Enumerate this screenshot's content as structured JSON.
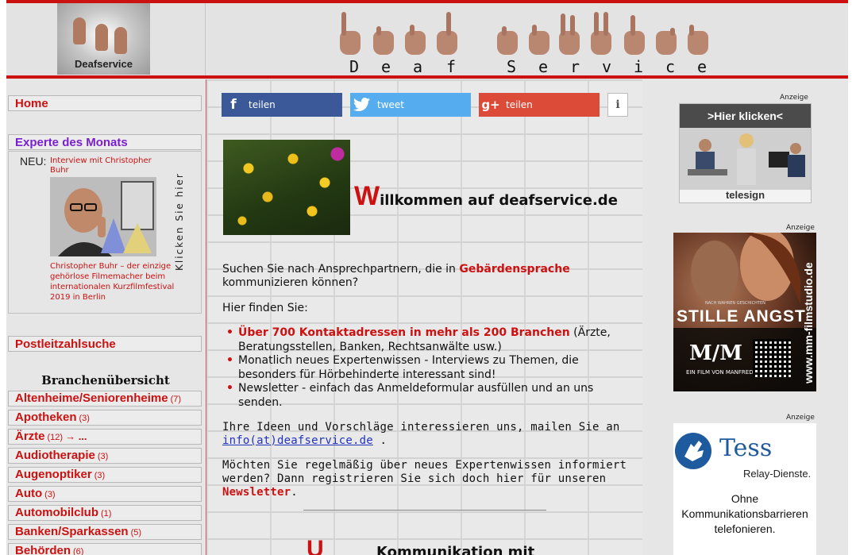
{
  "header": {
    "logo_text": "Deafservice",
    "letters": [
      "D",
      "e",
      "a",
      "f",
      "S",
      "e",
      "r",
      "v",
      "i",
      "c",
      "e"
    ]
  },
  "sidebar": {
    "home": "Home",
    "expert_heading": "Experte des Monats",
    "expert_new": "NEU:",
    "expert_title": "Interview mit Christopher Buhr",
    "expert_caption": "Christopher Buhr – der einzige gehörlose Filmemacher beim internationalen Kurzfilmfestival 2019 in Berlin",
    "click_here": "Klicken Sie hier",
    "plz_search": "Postleitzahlsuche",
    "branch_heading": "Branchenübersicht",
    "branches": [
      {
        "name": "Altenheime/Seniorenheime",
        "count": "(7)"
      },
      {
        "name": "Apotheken",
        "count": "(3)"
      },
      {
        "name": "Ärzte",
        "count": "(12)",
        "more": "→ ..."
      },
      {
        "name": "Audiotherapie",
        "count": "(3)"
      },
      {
        "name": "Augenoptiker",
        "count": "(3)"
      },
      {
        "name": "Auto",
        "count": "(3)"
      },
      {
        "name": "Automobilclub",
        "count": "(1)"
      },
      {
        "name": "Banken/Sparkassen",
        "count": "(5)"
      },
      {
        "name": "Behörden",
        "count": "(6)"
      }
    ]
  },
  "share": {
    "facebook": "teilen",
    "twitter": "tweet",
    "google": "teilen",
    "info": "i"
  },
  "main": {
    "welcome_initial": "W",
    "welcome_rest": "illkommen auf deafservice.de",
    "intro_a": "Suchen Sie nach Ansprechpartnern, die in ",
    "intro_highlight": "Gebärdensprache",
    "intro_b": "kommunizieren können?",
    "find_here": "Hier finden Sie:",
    "bullet1_highlight": "Über 700 Kontaktadressen in mehr als 200 Branchen",
    "bullet1_rest": " (Ärzte, Beratungsstellen, Banken, Rechtsanwälte usw.)",
    "bullet2": "Monatlich neues Expertenwissen - Interviews zu Themen, die besonders für Hörbehinderte interessant sind!",
    "bullet3": "Newsletter - einfach das Anmeldeformular ausfüllen und an uns senden.",
    "ideas_text": "Ihre Ideen und Vorschläge interessieren uns, mailen Sie an",
    "email": "info(at)deafservice.de",
    "ideas_end": " .",
    "newsletter_text": "Möchten Sie regelmäßig über neues Expertenwissen informiert werden? Dann registrieren Sie sich doch hier für unseren",
    "newsletter_link": "Newsletter",
    "newsletter_end": ".",
    "bottom_initial": "U",
    "bottom_rest": "Kommunikation mit"
  },
  "ads": {
    "label": "Anzeige",
    "telesign_header": ">Hier klicken<",
    "telesign_brand": "telesign",
    "film_title": "STILLE  ANGST",
    "film_logo": "M/M",
    "film_sub": "EIN FILM VON MANFRED MERTZ",
    "film_small": "NACH WAHREN GESCHICHTEN",
    "film_url": "www.mm-filmstudio.de",
    "tess_name": "Tess",
    "tess_relay": "Relay-Dienste.",
    "tess_claim_1": "Ohne",
    "tess_claim_2": "Kommunikationsbarrieren",
    "tess_claim_3": "telefonieren."
  },
  "colors": {
    "accent_red": "#cc1111",
    "expert_purple": "#7a1fd0",
    "facebook": "#3b5998",
    "twitter": "#55acee",
    "google": "#dc4a38"
  }
}
